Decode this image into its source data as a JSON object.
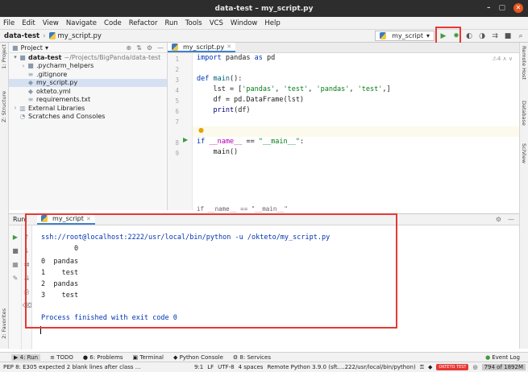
{
  "window": {
    "title": "data-test – my_script.py",
    "controls": {
      "minimize": "–",
      "maximize": "▢",
      "close": "✕"
    }
  },
  "menu": [
    "File",
    "Edit",
    "View",
    "Navigate",
    "Code",
    "Refactor",
    "Run",
    "Tools",
    "VCS",
    "Window",
    "Help"
  ],
  "navbar": {
    "project": "data-test",
    "file": "my_script.py",
    "run_config": "my_script",
    "run_config_arrow": "▾"
  },
  "left_strip": {
    "project": "1: Project",
    "structure": "Z: Structure",
    "favorites": "2: Favorites"
  },
  "right_strip": {
    "remote_host": "Remote Host",
    "database": "Database",
    "sciview": "SciView"
  },
  "project_panel": {
    "title": "Project",
    "dropdown": "▾",
    "tree": [
      {
        "arrow": "▾",
        "icon": "■",
        "label": "data-test",
        "extra": "~/Projects/BigPanda/data-test",
        "indent": 0,
        "bold": true
      },
      {
        "arrow": "›",
        "icon": "■",
        "label": ".pycharm_helpers",
        "extra": "",
        "indent": 1
      },
      {
        "arrow": "",
        "icon": "≡",
        "label": ".gitignore",
        "extra": "",
        "indent": 1
      },
      {
        "arrow": "",
        "icon": "◆",
        "label": "my_script.py",
        "extra": "",
        "indent": 1,
        "selected": true
      },
      {
        "arrow": "",
        "icon": "◆",
        "label": "okteto.yml",
        "extra": "",
        "indent": 1
      },
      {
        "arrow": "",
        "icon": "≡",
        "label": "requirements.txt",
        "extra": "",
        "indent": 1
      },
      {
        "arrow": "›",
        "icon": "▥",
        "label": "External Libraries",
        "extra": "",
        "indent": 0
      },
      {
        "arrow": "",
        "icon": "◔",
        "label": "Scratches and Consoles",
        "extra": "",
        "indent": 0
      }
    ]
  },
  "editor": {
    "tab": "my_script.py",
    "inspection": "⚠4 ∧ ∨",
    "line_numbers": [
      "1",
      "2",
      "3",
      "4",
      "5",
      "6",
      "7",
      "8",
      "9"
    ],
    "code_breadcrumb": "if __name__ == \"__main__\""
  },
  "run_panel": {
    "label": "Run:",
    "tab": "my_script",
    "command": "ssh://root@localhost:2222/usr/local/bin/python -u /okteto/my_script.py",
    "header_line": "        0",
    "rows": [
      {
        "index": "0",
        "value": "pandas"
      },
      {
        "index": "1",
        "value": "  test"
      },
      {
        "index": "2",
        "value": "pandas"
      },
      {
        "index": "3",
        "value": "  test"
      }
    ],
    "finished": "Process finished with exit code 0"
  },
  "tool_windows": [
    {
      "label": "4: Run",
      "icon": "▶",
      "active": true
    },
    {
      "label": "TODO",
      "icon": "≡"
    },
    {
      "label": "6: Problems",
      "icon": "●"
    },
    {
      "label": "Terminal",
      "icon": "▣"
    },
    {
      "label": "Python Console",
      "icon": "◆"
    },
    {
      "label": "8: Services",
      "icon": "⚙"
    }
  ],
  "event_log": "Event Log",
  "status": {
    "message": "PEP 8: E305 expected 2 blank lines after class ...",
    "position": "9:1",
    "line_sep": "LF",
    "encoding": "UTF-8",
    "indent": "4 spaces",
    "interpreter": "Remote Python 3.9.0 (sft....222/usr/local/bin/python)",
    "okteto_badge": "OKTETO TEST",
    "memory": "794 of 1892M"
  },
  "colors": {
    "accent": "#4083c9",
    "highlight": "#e53935",
    "run_green": "#3f9b3f"
  }
}
